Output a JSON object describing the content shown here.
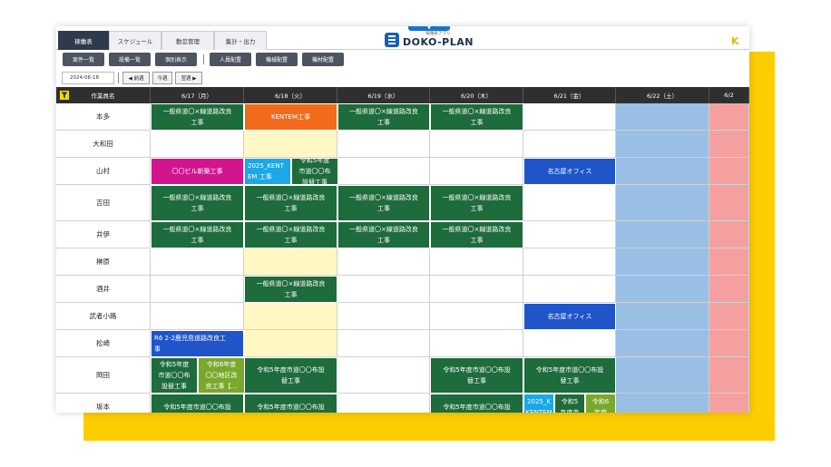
{
  "colors": {
    "header_dark": "#2f2f2f",
    "green": "#1e6b3c",
    "orange": "#f26a1b",
    "magenta": "#d2158f",
    "blue": "#1f55c8",
    "cyan": "#1aa8e8",
    "olive": "#7aa82c",
    "light_yellow": "#fff8c4",
    "sat_blue": "#99bfe5",
    "sun_pink": "#f5a0a0",
    "deco_yellow": "#fccd00"
  },
  "main_tabs": [
    "稼働表",
    "スケジュール",
    "勤怠管理",
    "集計・出力"
  ],
  "app": {
    "logo_sub": "稼働表アプリ",
    "logo_name": "DOKO-PLAN",
    "drop": "▼",
    "corner": "K"
  },
  "toolbar": [
    "案件一覧",
    "設備一覧",
    "個別表示",
    "人員配置",
    "機械配置",
    "機材配置"
  ],
  "datebar": {
    "date": "2024-06-18",
    "prev": "◀ 前週",
    "today": "今週",
    "next": "翌週 ▶"
  },
  "grid": {
    "name_header": "作業員名",
    "days": [
      "6/17（月）",
      "6/18（火）",
      "6/19（水）",
      "6/20（木）",
      "6/21（金）",
      "6/22（土）",
      "6/2"
    ],
    "workers": [
      "本多",
      "大和田",
      "山村",
      "吉田",
      "井伊",
      "榊原",
      "酒井",
      "武者小路",
      "松崎",
      "岡田",
      "坂本"
    ],
    "events": [
      {
        "row": 0,
        "col": 0,
        "lines": [
          "一般県道〇×線道路改良",
          "工事"
        ],
        "color": "green"
      },
      {
        "row": 0,
        "col": 1,
        "lines": [
          "KENTEM工事"
        ],
        "color": "orange"
      },
      {
        "row": 0,
        "col": 2,
        "lines": [
          "一般県道〇×線道路改良",
          "工事"
        ],
        "color": "green"
      },
      {
        "row": 0,
        "col": 3,
        "lines": [
          "一般県道〇×線道路改良",
          "工事"
        ],
        "color": "green"
      },
      {
        "row": 2,
        "col": 0,
        "lines": [
          "〇〇ビル新築工事"
        ],
        "color": "magenta"
      },
      {
        "row": 2,
        "col": 1,
        "sub": 0,
        "lines": [
          "2025_KENT",
          "EM 工事"
        ],
        "color": "cyan",
        "align": "left"
      },
      {
        "row": 2,
        "col": 1,
        "sub": 1,
        "lines": [
          "令和5年度",
          "市道〇〇布",
          "設替工事"
        ],
        "color": "green"
      },
      {
        "row": 2,
        "col": 4,
        "lines": [
          "名古屋オフィス"
        ],
        "color": "blue"
      },
      {
        "row": 3,
        "col": 0,
        "lines": [
          "一般県道〇×線道路改良",
          "工事"
        ],
        "color": "green"
      },
      {
        "row": 3,
        "col": 1,
        "lines": [
          "一般県道〇×線道路改良",
          "工事"
        ],
        "color": "green"
      },
      {
        "row": 3,
        "col": 2,
        "lines": [
          "一般県道〇×線道路改良",
          "工事"
        ],
        "color": "green"
      },
      {
        "row": 3,
        "col": 3,
        "lines": [
          "一般県道〇×線道路改良",
          "工事"
        ],
        "color": "green"
      },
      {
        "row": 4,
        "col": 0,
        "lines": [
          "一般県道〇×線道路改良",
          "工事"
        ],
        "color": "green"
      },
      {
        "row": 4,
        "col": 1,
        "lines": [
          "一般県道〇×線道路改良",
          "工事"
        ],
        "color": "green"
      },
      {
        "row": 4,
        "col": 2,
        "lines": [
          "一般県道〇×線道路改良",
          "工事"
        ],
        "color": "green"
      },
      {
        "row": 4,
        "col": 3,
        "lines": [
          "一般県道〇×線道路改良",
          "工事"
        ],
        "color": "green"
      },
      {
        "row": 6,
        "col": 1,
        "lines": [
          "一般県道〇×線道路改良",
          "工事"
        ],
        "color": "green"
      },
      {
        "row": 7,
        "col": 4,
        "lines": [
          "名古屋オフィス"
        ],
        "color": "blue"
      },
      {
        "row": 8,
        "col": 0,
        "lines": [
          "R6 2-2鹿児島道路改良工",
          "事"
        ],
        "color": "blue",
        "align": "left"
      },
      {
        "row": 9,
        "col": 0,
        "sub": 0,
        "lines": [
          "令和5年度",
          "市道〇〇布",
          "設替工事"
        ],
        "color": "green"
      },
      {
        "row": 9,
        "col": 0,
        "sub": 1,
        "lines": [
          "令和6年度",
          "〇〇地区改",
          "良工事【…"
        ],
        "color": "olive"
      },
      {
        "row": 9,
        "col": 1,
        "lines": [
          "令和5年度市道〇〇布設",
          "替工事"
        ],
        "color": "green"
      },
      {
        "row": 9,
        "col": 3,
        "lines": [
          "令和5年度市道〇〇布設",
          "替工事"
        ],
        "color": "green"
      },
      {
        "row": 9,
        "col": 4,
        "lines": [
          "令和5年度市道〇〇布設",
          "替工事"
        ],
        "color": "green"
      },
      {
        "row": 10,
        "col": 0,
        "lines": [
          "令和5年度市道〇〇布設"
        ],
        "color": "green"
      },
      {
        "row": 10,
        "col": 1,
        "lines": [
          "令和5年度市道〇〇布設"
        ],
        "color": "green"
      },
      {
        "row": 10,
        "col": 3,
        "lines": [
          "令和5年度市道〇〇布設"
        ],
        "color": "green"
      },
      {
        "row": 10,
        "col": 4,
        "sub3": 0,
        "lines": [
          "2025_K",
          "KENTEM"
        ],
        "color": "cyan"
      },
      {
        "row": 10,
        "col": 4,
        "sub3": 1,
        "lines": [
          "令和5",
          "年度市"
        ],
        "color": "green"
      },
      {
        "row": 10,
        "col": 4,
        "sub3": 2,
        "lines": [
          "令和6",
          "年度"
        ],
        "color": "olive"
      }
    ],
    "yellow_cells": [
      [
        1,
        1
      ],
      [
        5,
        1
      ],
      [
        7,
        1
      ],
      [
        8,
        1
      ]
    ]
  }
}
